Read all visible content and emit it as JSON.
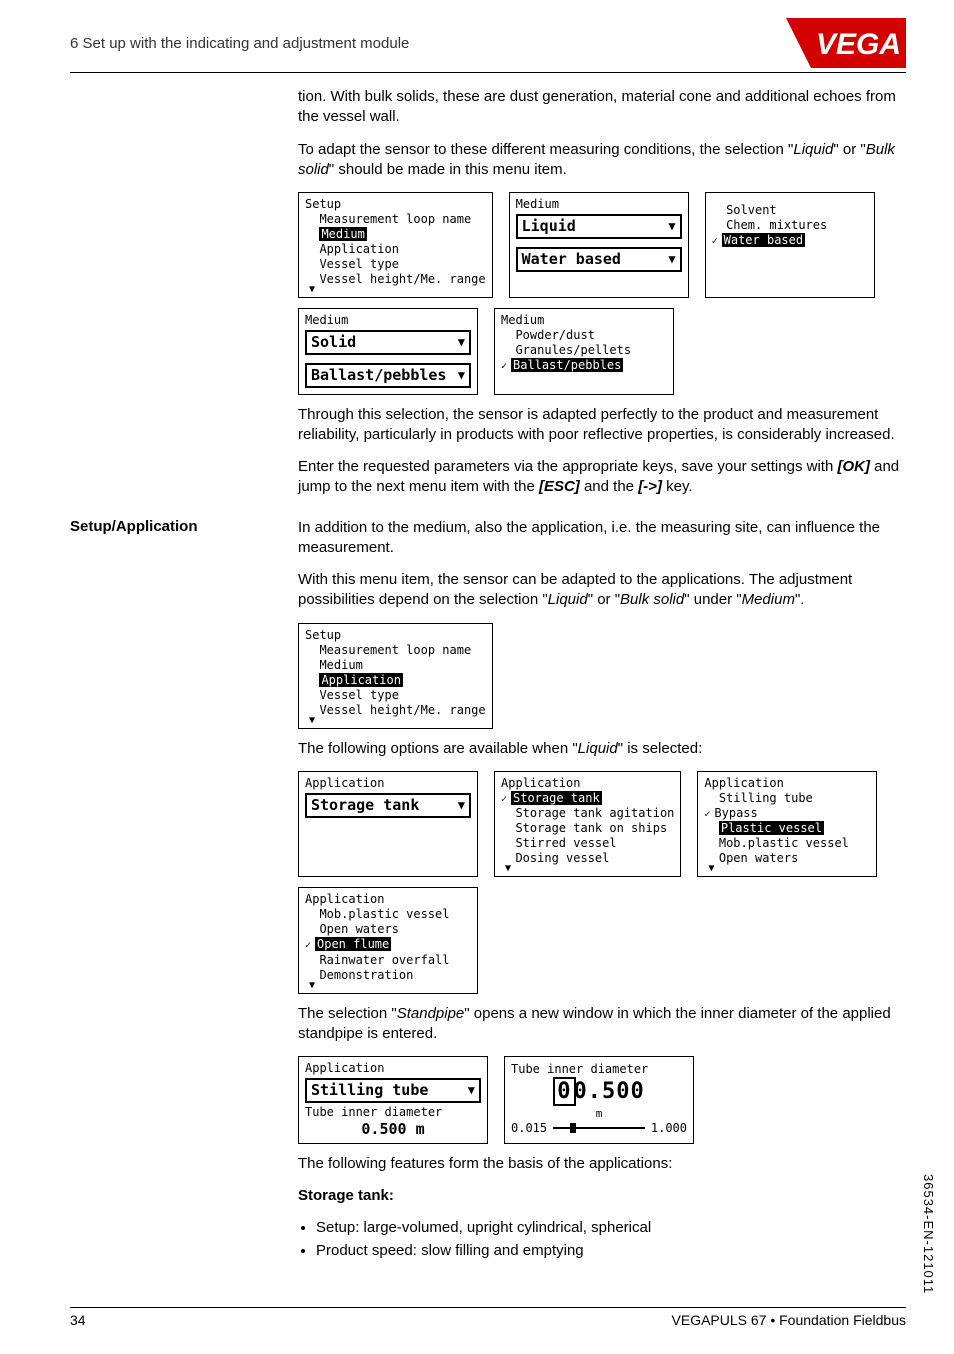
{
  "header": {
    "section": "6 Set up with the indicating and adjustment module"
  },
  "p1": "tion. With bulk solids, these are dust generation, material cone and additional echoes from the vessel wall.",
  "p2a": "To adapt the sensor to these different measuring conditions, the selection \"",
  "p2b": "Liquid",
  "p2c": "\" or \"",
  "p2d": "Bulk solid",
  "p2e": "\" should be made in this menu item.",
  "lcd_setup": {
    "title": "Setup",
    "i1": "Measurement loop name",
    "i2": "Medium",
    "i3": "Application",
    "i4": "Vessel type",
    "i5": "Vessel height/Me. range"
  },
  "lcd_medium_liquid": {
    "title": "Medium",
    "f1": "Liquid",
    "f2": "Water based"
  },
  "lcd_solvent": {
    "i1": "Solvent",
    "i2": "Chem. mixtures",
    "i3": "Water based"
  },
  "lcd_medium_solid": {
    "title": "Medium",
    "f1": "Solid",
    "f2": "Ballast/pebbles"
  },
  "lcd_solid_list": {
    "title": "Medium",
    "i1": "Powder/dust",
    "i2": "Granules/pellets",
    "i3": "Ballast/pebbles"
  },
  "p3": "Through this selection, the sensor is adapted perfectly to the product and measurement reliability, particularly in products with poor reflective properties, is considerably increased.",
  "p4a": "Enter the requested parameters via the appropriate keys, save your settings with ",
  "p4b": "[OK]",
  "p4c": " and jump to the next menu item with the ",
  "p4d": "[ESC]",
  "p4e": " and the ",
  "p4f": "[->]",
  "p4g": " key.",
  "side_app": "Setup/Application",
  "p5": "In addition to the medium, also the application, i.e. the measuring site, can influence the measurement.",
  "p6a": "With this menu item, the sensor can be adapted to the applications. The adjustment possibilities depend on the selection \"",
  "p6b": "Liquid",
  "p6c": "\" or \"",
  "p6d": "Bulk solid",
  "p6e": "\" under \"",
  "p6f": "Medium",
  "p6g": "\".",
  "lcd_setup2": {
    "title": "Setup",
    "i1": "Measurement loop name",
    "i2": "Medium",
    "i3": "Application",
    "i4": "Vessel type",
    "i5": "Vessel height/Me. range"
  },
  "p7a": "The following options are available when \"",
  "p7b": "Liquid",
  "p7c": "\" is selected:",
  "lcd_app_storage": {
    "title": "Application",
    "f1": "Storage tank"
  },
  "lcd_app_list1": {
    "title": "Application",
    "i1": "Storage tank",
    "i2": "Storage tank agitation",
    "i3": "Storage tank on ships",
    "i4": "Stirred vessel",
    "i5": "Dosing vessel"
  },
  "lcd_app_list2": {
    "title": "Application",
    "i1": "Stilling tube",
    "i2": "Bypass",
    "i3": "Plastic vessel",
    "i4": "Mob.plastic vessel",
    "i5": "Open waters"
  },
  "lcd_app_list3": {
    "title": "Application",
    "i1": "Mob.plastic vessel",
    "i2": "Open waters",
    "i3": "Open flume",
    "i4": "Rainwater overfall",
    "i5": "Demonstration"
  },
  "p8a": "The selection \"",
  "p8b": "Standpipe",
  "p8c": "\" opens a new window in which the inner diameter of the applied standpipe is entered.",
  "lcd_still": {
    "title": "Application",
    "f1": "Stilling tube",
    "sub": "Tube inner diameter",
    "val": "0.500 m"
  },
  "lcd_diam": {
    "title": "Tube inner diameter",
    "big": "00.500",
    "unit": "m",
    "lo": "0.015",
    "hi": "1.000"
  },
  "p9": "The following features form the basis of the applications:",
  "st_title": "Storage tank:",
  "b1": "Setup: large-volumed, upright cylindrical, spherical",
  "b2": "Product speed: slow filling and emptying",
  "footer": {
    "page": "34",
    "doc": "VEGAPULS 67 • Foundation Fieldbus"
  },
  "docid": "36534-EN-121011"
}
